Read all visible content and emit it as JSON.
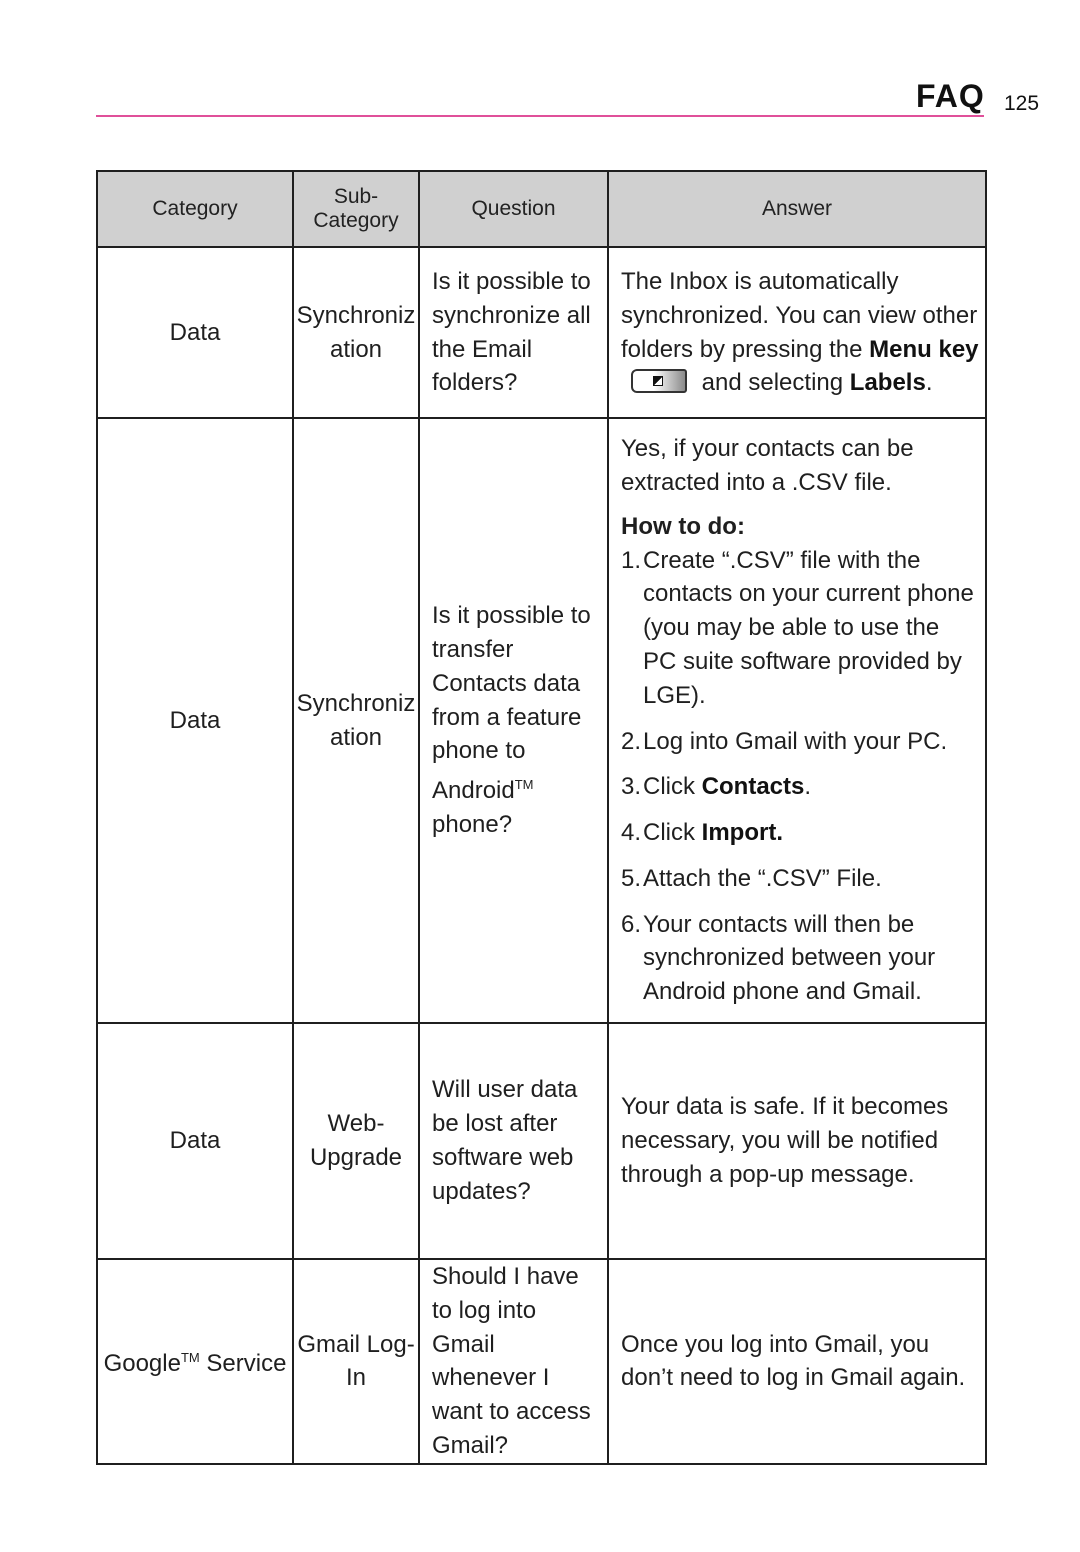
{
  "header": {
    "title": "FAQ",
    "page_number": "125",
    "accent_color": "#e0509a"
  },
  "table": {
    "columns": [
      "Category",
      "Sub-\nCategory",
      "Question",
      "Answer"
    ],
    "column_sub_1": "Sub-",
    "column_sub_2": "Category",
    "rows": [
      {
        "category": "Data",
        "subcategory_1": "Synchroniz",
        "subcategory_2": "ation",
        "question": "Is it possible to synchronize all the Email folders?",
        "answer": {
          "part1": "The Inbox is automatically synchronized. You can view other folders by pressing the ",
          "bold1": "Menu",
          "part2": " key",
          "icon": "menu-key-icon",
          "part3": " and selecting ",
          "bold2": "Labels",
          "part4": "."
        }
      },
      {
        "category": "Data",
        "subcategory_1": "Synchroniz",
        "subcategory_2": "ation",
        "question": "Is it possible to transfer Contacts data from a feature phone to Android",
        "question_tm": "TM",
        "question_end": " phone?",
        "answer": {
          "intro": "Yes, if your contacts can be extracted into a .CSV file.",
          "howto": "How to do:",
          "steps": [
            {
              "num": "1.",
              "text": "Create “.CSV” file with the contacts on your current phone (you may be able to use the PC suite software provided by LGE)."
            },
            {
              "num": "2.",
              "text": "Log into Gmail with your PC."
            },
            {
              "num": "3.",
              "text_pre": "Click ",
              "bold": "Contacts",
              "text_post": "."
            },
            {
              "num": "4.",
              "text_pre": "Click ",
              "bold": "Import.",
              "text_post": ""
            },
            {
              "num": "5.",
              "text": "Attach the “.CSV” File."
            },
            {
              "num": "6.",
              "text": "Your contacts will then be synchronized between your Android phone and Gmail."
            }
          ]
        }
      },
      {
        "category": "Data",
        "subcategory_1": "Web-",
        "subcategory_2": "Upgrade",
        "question": "Will user data be lost after software web updates?",
        "answer": "Your data is safe. If it becomes necessary, you will be notified through a pop-up message."
      },
      {
        "category_pre": "Google",
        "category_tm": "TM",
        "category_post": " Service",
        "subcategory_1": "Gmail Log-",
        "subcategory_2": "In",
        "question": "Should I have to log into Gmail whenever I want to access Gmail?",
        "answer": "Once you log into Gmail, you don’t need to log in Gmail again."
      }
    ]
  }
}
